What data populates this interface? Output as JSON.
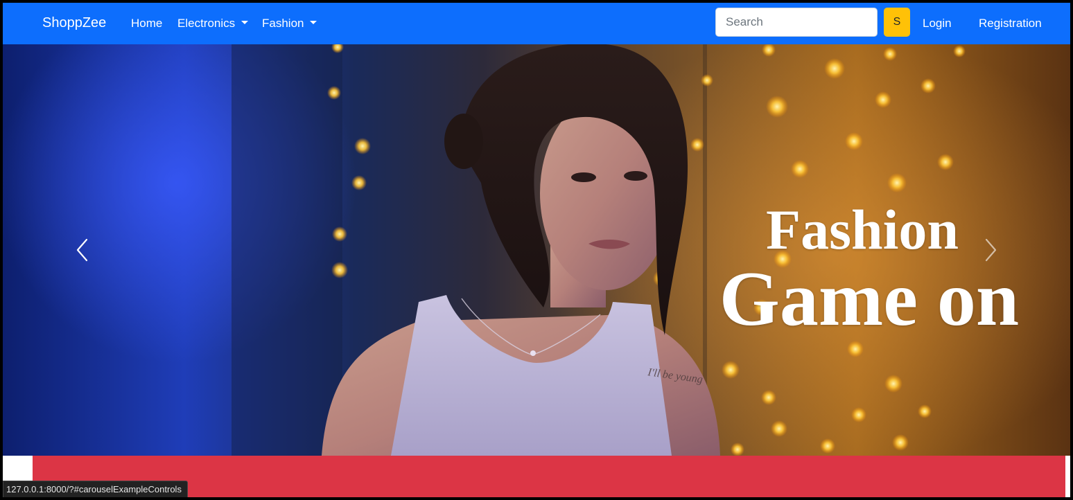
{
  "navbar": {
    "brand": "ShoppZee",
    "links": [
      {
        "label": "Home"
      },
      {
        "label": "Electronics"
      },
      {
        "label": "Fashion"
      }
    ],
    "search": {
      "placeholder": "Search",
      "value": ""
    },
    "search_button_label": "S",
    "login_label": "Login",
    "registration_label": "Registration"
  },
  "carousel": {
    "caption_line1": "Fashion",
    "caption_line2": "Game on",
    "prev_icon": "chevron-left-icon",
    "next_icon": "chevron-right-icon"
  },
  "status_bar": {
    "url": "127.0.0.1:8000/?#carouselExampleControls"
  },
  "colors": {
    "navbar_bg": "#0d6efd",
    "search_button_bg": "#ffc107",
    "promo_band_bg": "#dc3545"
  }
}
